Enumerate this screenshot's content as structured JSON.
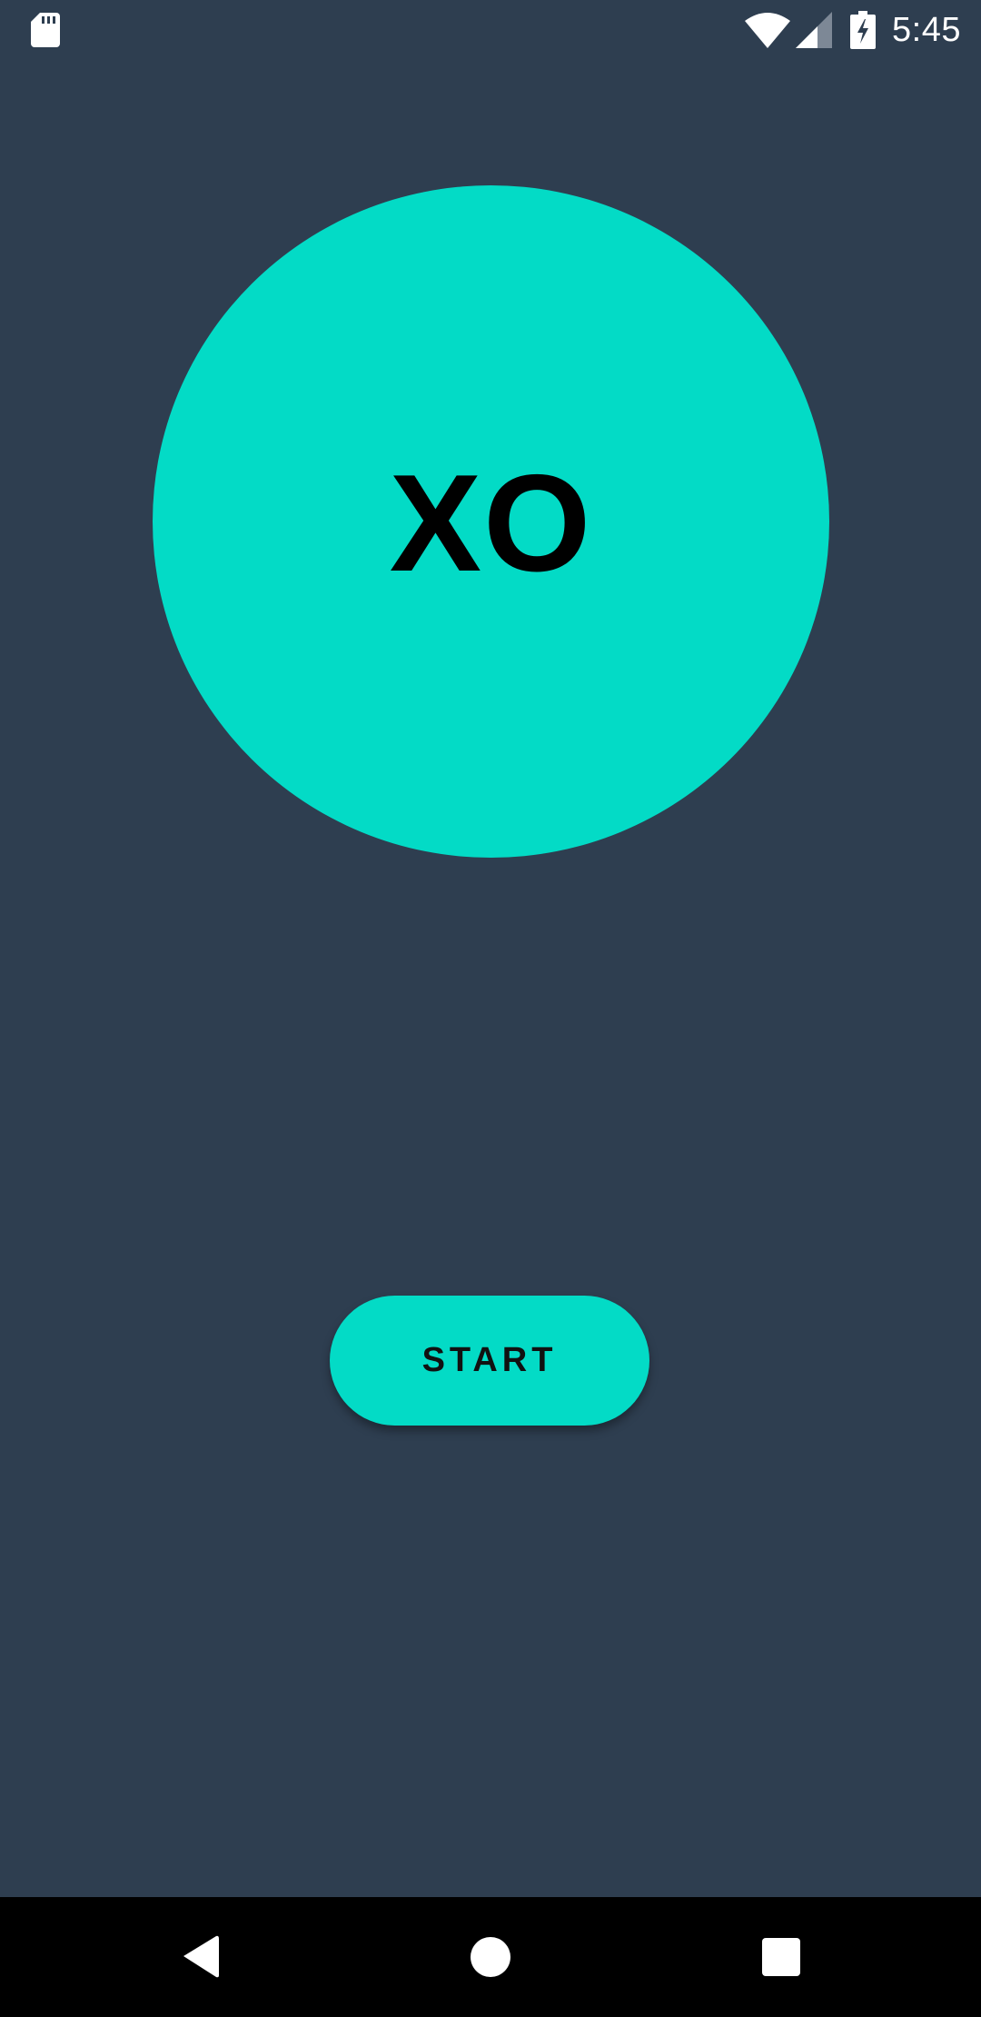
{
  "status_bar": {
    "time": "5:45",
    "icons": [
      "sd-card-icon",
      "wifi-icon",
      "signal-icon",
      "battery-charging-icon"
    ]
  },
  "logo": {
    "text": "XO"
  },
  "start_button": {
    "label": "START"
  },
  "nav_bar": {
    "icons": [
      "back-icon",
      "home-icon",
      "recents-icon"
    ]
  },
  "colors": {
    "background": "#2e3e50",
    "accent": "#03dbc6",
    "text_dark": "#000000",
    "nav_bar": "#000000"
  }
}
